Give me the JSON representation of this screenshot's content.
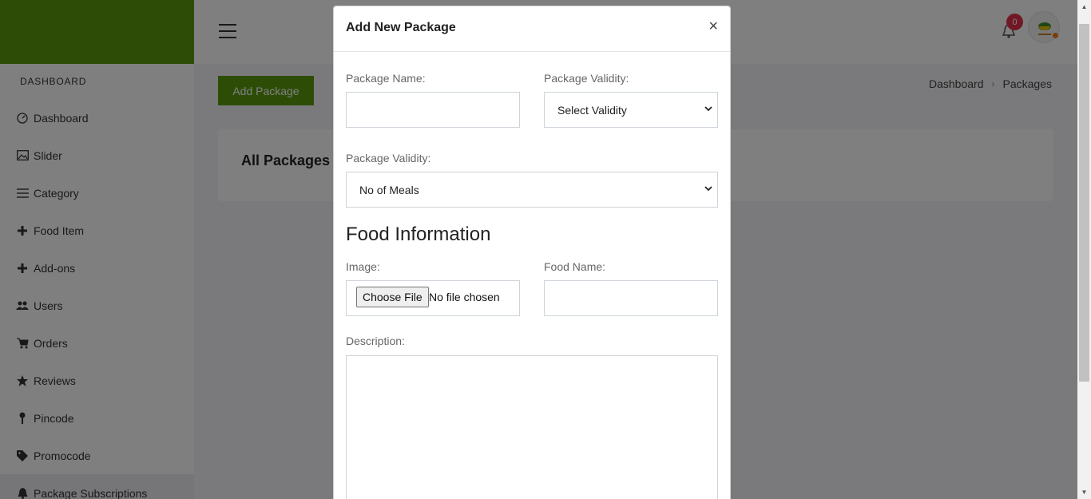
{
  "sidebar": {
    "section_title": "DASHBOARD",
    "items": [
      {
        "label": "Dashboard",
        "icon": "gauge-icon"
      },
      {
        "label": "Slider",
        "icon": "image-icon"
      },
      {
        "label": "Category",
        "icon": "list-icon"
      },
      {
        "label": "Food Item",
        "icon": "plus-icon"
      },
      {
        "label": "Add-ons",
        "icon": "plus-icon"
      },
      {
        "label": "Users",
        "icon": "users-icon"
      },
      {
        "label": "Orders",
        "icon": "cart-icon"
      },
      {
        "label": "Reviews",
        "icon": "star-icon"
      },
      {
        "label": "Pincode",
        "icon": "pin-icon"
      },
      {
        "label": "Promocode",
        "icon": "tag-icon"
      },
      {
        "label": "Package Subscriptions",
        "icon": "bell-icon"
      }
    ]
  },
  "topbar": {
    "notification_count": "0"
  },
  "main": {
    "add_button": "Add Package",
    "breadcrumb": [
      "Dashboard",
      "Packages"
    ],
    "card_title": "All Packages"
  },
  "modal": {
    "title": "Add New Package",
    "close": "×",
    "package_name_label": "Package Name:",
    "package_name_value": "",
    "validity_label": "Package Validity:",
    "validity_selected": "Select Validity",
    "meals_label": "Package Validity:",
    "meals_selected": "No of Meals",
    "section_heading": "Food Information",
    "image_label": "Image:",
    "choose_file": "Choose File",
    "no_file": "No file chosen",
    "food_name_label": "Food Name:",
    "food_name_value": "",
    "description_label": "Description:",
    "description_value": ""
  },
  "colors": {
    "brand": "#5a9a0f",
    "badge": "#e0324a"
  }
}
